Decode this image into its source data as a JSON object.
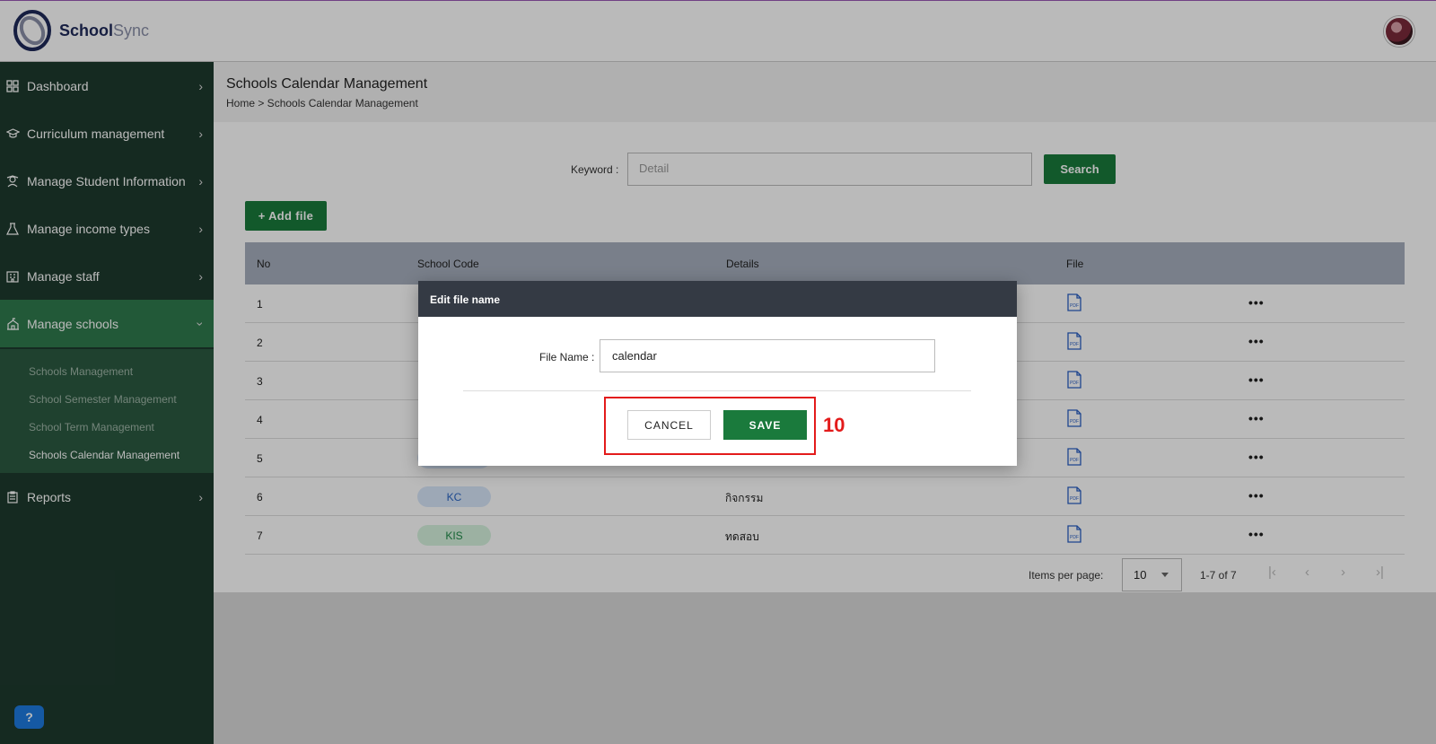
{
  "brand": {
    "name_part1": "School",
    "name_part2": "Sync"
  },
  "sidebar": {
    "items": [
      {
        "label": "Dashboard",
        "icon": "grid-icon"
      },
      {
        "label": "Curriculum management",
        "icon": "graduation-cap-icon"
      },
      {
        "label": "Manage Student Information",
        "icon": "student-icon"
      },
      {
        "label": "Manage income types",
        "icon": "flask-icon"
      },
      {
        "label": "Manage staff",
        "icon": "building-icon"
      },
      {
        "label": "Manage schools",
        "icon": "school-icon"
      },
      {
        "label": "Reports",
        "icon": "clipboard-icon"
      }
    ],
    "submenu": [
      "Schools Management",
      "School Semester Management",
      "School Term Management",
      "Schools Calendar Management"
    ]
  },
  "page": {
    "title": "Schools Calendar Management",
    "breadcrumb": "Home > Schools Calendar Management"
  },
  "search": {
    "label": "Keyword :",
    "placeholder": "Detail",
    "button": "Search"
  },
  "add_button": "+ Add file",
  "table": {
    "headers": [
      "No",
      "School Code",
      "Details",
      "File"
    ],
    "rows": [
      {
        "no": "1",
        "code": "",
        "detail": ""
      },
      {
        "no": "2",
        "code": "",
        "detail": ""
      },
      {
        "no": "3",
        "code": "",
        "detail": ""
      },
      {
        "no": "4",
        "code": "",
        "detail": ""
      },
      {
        "no": "5",
        "code": "",
        "detail": ""
      },
      {
        "no": "6",
        "code": "KC",
        "detail": "กิจกรรม"
      },
      {
        "no": "7",
        "code": "KIS",
        "detail": "ทดสอบ"
      }
    ]
  },
  "pager": {
    "label": "Items per page:",
    "size": "10",
    "range": "1-7 of 7"
  },
  "modal": {
    "title": "Edit file name",
    "field_label": "File Name :",
    "field_value": "calendar",
    "cancel": "CANCEL",
    "save": "SAVE"
  },
  "annotation": {
    "step": "10",
    "color": "#e31b1b"
  },
  "colors": {
    "primary_green": "#1a7a3c",
    "sidebar_bg": "#1e3a2e",
    "active_nav": "#2f7a4d"
  }
}
